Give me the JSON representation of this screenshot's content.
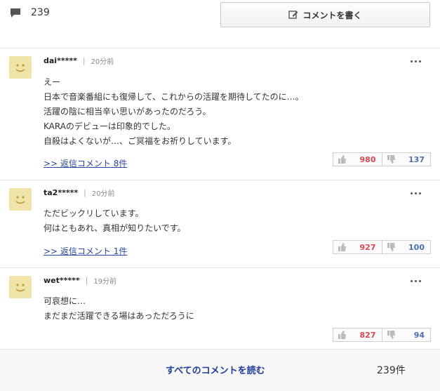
{
  "header": {
    "comment_count": "239",
    "write_button_label": "コメントを書く"
  },
  "comments": [
    {
      "user": "dai*****",
      "time": "20分前",
      "lines": [
        "えー",
        "日本で音楽番組にも復帰して、これからの活躍を期待してたのに…。",
        "活躍の陰に相当辛い思いがあったのだろう。",
        "KARAのデビューは印象的でした。",
        "自殺はよくないが…、ご冥福をお祈りしています。"
      ],
      "reply_link": ">> 返信コメント 8件",
      "likes": "980",
      "dislikes": "137"
    },
    {
      "user": "ta2*****",
      "time": "20分前",
      "lines": [
        "ただビックリしています。",
        "何はともあれ、真相が知りたいです。"
      ],
      "reply_link": ">> 返信コメント 1件",
      "likes": "927",
      "dislikes": "100"
    },
    {
      "user": "wet*****",
      "time": "19分前",
      "lines": [
        "可哀想に…",
        "まだまだ活躍できる場はあっただろうに"
      ],
      "likes": "827",
      "dislikes": "94"
    }
  ],
  "footer": {
    "all_comments_label": "すべてのコメントを読む",
    "total": "239件"
  },
  "colors": {
    "avatar_bg": "#f0e4a8",
    "like": "#e0474c",
    "dislike": "#4a6fb5",
    "link": "#1e3c9e"
  },
  "icons": [
    "speech-bubble-icon",
    "pen-icon",
    "more-icon",
    "thumbs-up-icon",
    "thumbs-down-icon",
    "smiley-avatar"
  ]
}
